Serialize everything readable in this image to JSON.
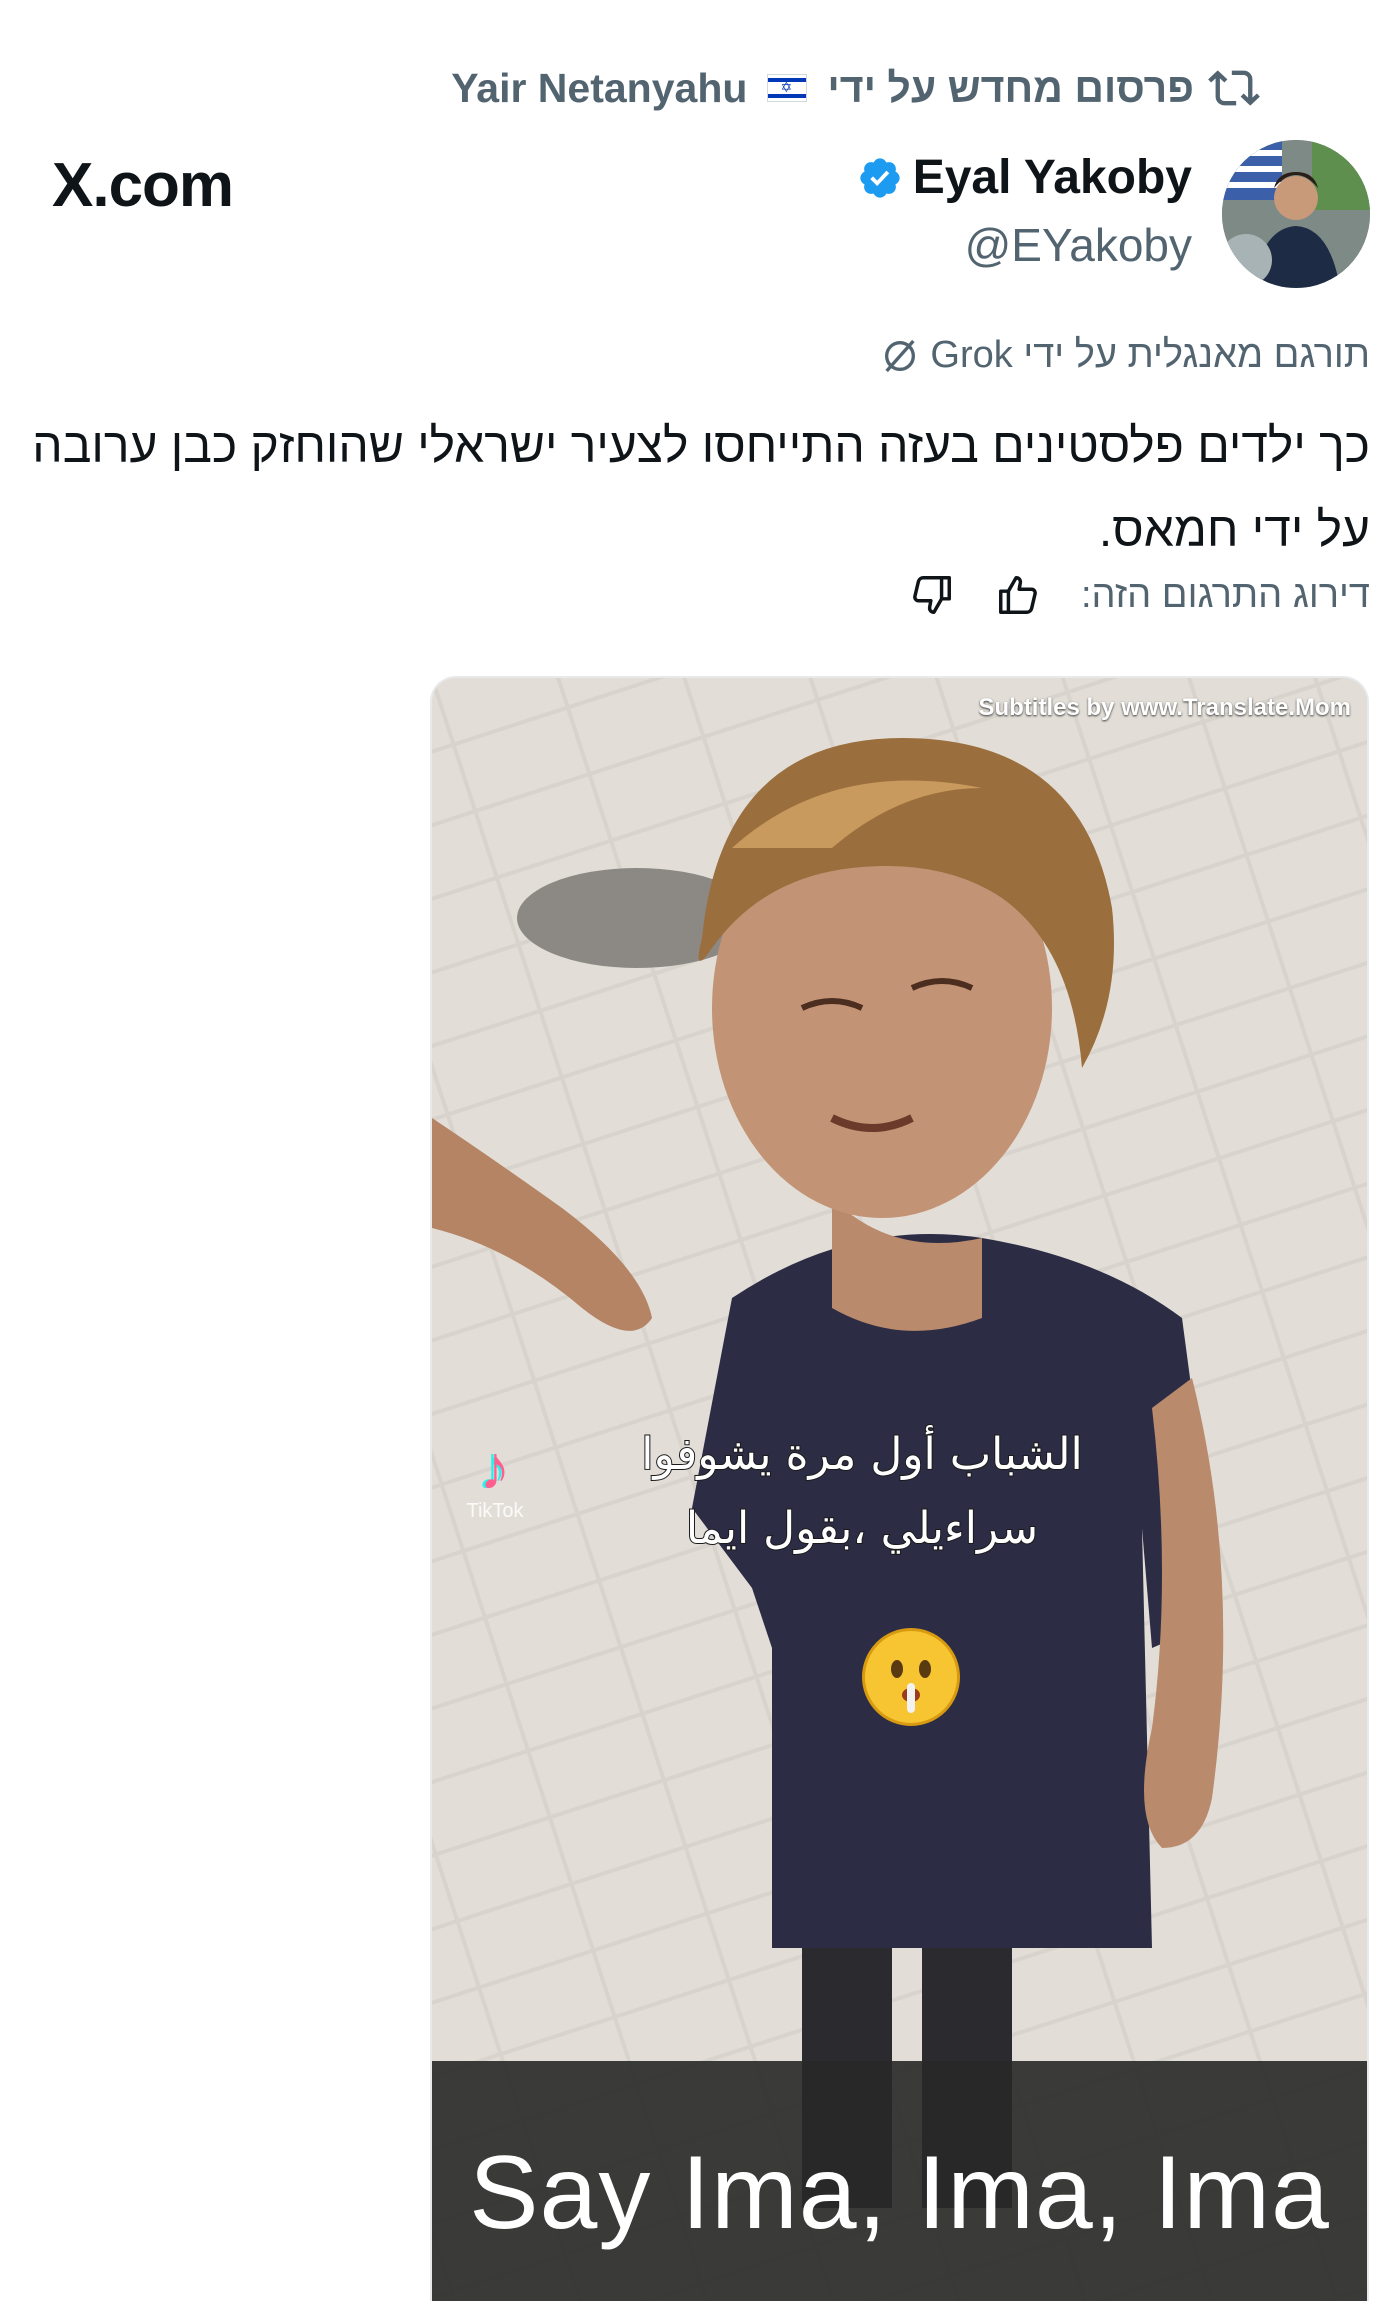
{
  "repost": {
    "label": "פרסום מחדש על ידי",
    "user": "Yair Netanyahu",
    "flag_icon": "israel-flag-icon",
    "icon": "repost-icon"
  },
  "site_label": "X.com",
  "author": {
    "display_name": "Eyal Yakoby",
    "handle": "@EYakoby",
    "verified_icon": "verified-badge-icon",
    "verified_color": "#1d9bf0"
  },
  "translation": {
    "label": "תורגם מאנגלית על ידי Grok",
    "icon": "translate-slash-icon"
  },
  "tweet": {
    "text": "כך ילדים פלסטינים בעזה התייחסו לצעיר ישראלי שהוחזק כבן ערובה על ידי חמאס."
  },
  "rate_translation": {
    "label": "דירוג התרגום הזה:",
    "thumbs_up_icon": "thumbs-up-icon",
    "thumbs_down_icon": "thumbs-down-icon"
  },
  "media": {
    "watermark": "Subtitles by www.Translate.Mom",
    "arabic_caption_line1": "الشباب أول مرة يشوفوا",
    "arabic_caption_line2": "سراءيلي ،بقول ايما",
    "tiktok_label": "TikTok",
    "emoji_icon": "shushing-face-emoji",
    "subtitle": "Say Ima, Ima, Ima"
  }
}
